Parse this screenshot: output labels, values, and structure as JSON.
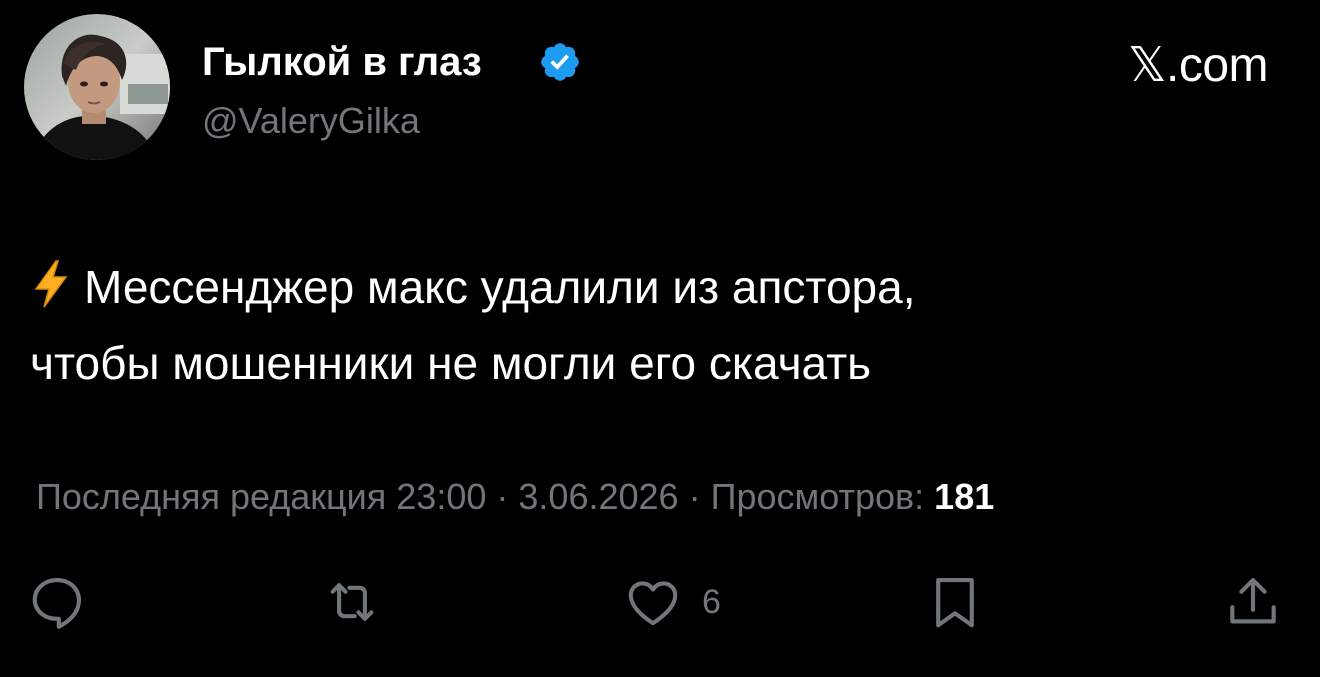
{
  "author": {
    "display_name": "Гылкой в глаз",
    "handle": "@ValeryGilka",
    "verified": true,
    "avatar": "avatar-photo"
  },
  "site_mark": "𝕏.com",
  "tweet": {
    "prefix_icon": "lightning-icon",
    "lines": [
      "Мессенджер макс удалили из апстора,",
      "чтобы мошенники не могли его скачать"
    ]
  },
  "meta": {
    "edited_label": "Последняя редакция",
    "time": "23:00",
    "separator": "·",
    "date": "3.06.2026",
    "views_label": "Просмотров:",
    "views_count": "181"
  },
  "actions": {
    "reply_icon": "reply-icon",
    "repost_icon": "repost-icon",
    "like_icon": "heart-icon",
    "like_count": "6",
    "bookmark_icon": "bookmark-icon",
    "share_icon": "share-icon"
  },
  "colors": {
    "background": "#000000",
    "text": "#ffffff",
    "muted": "#71767b",
    "verified_badge": "#1d9bf0",
    "lightning": "#ffb020"
  }
}
